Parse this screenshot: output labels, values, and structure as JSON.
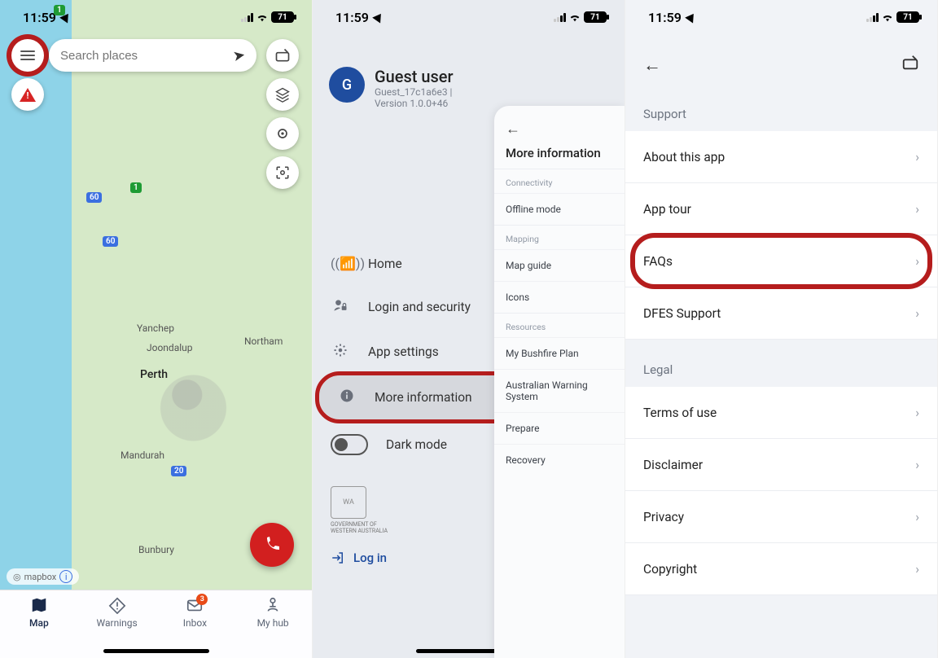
{
  "status_bar": {
    "time": "11:59",
    "battery": "71"
  },
  "screen1": {
    "search_placeholder": "Search places",
    "route60": "60",
    "route60b": "60",
    "route20": "20",
    "badge1": "1",
    "badge1b": "1",
    "label_yanchep": "Yanchep",
    "label_northam": "Northam",
    "label_joondalup": "Joondalup",
    "label_perth": "Perth",
    "label_mandurah": "Mandurah",
    "label_bunbury": "Bunbury",
    "mapbox": "mapbox",
    "tabs": {
      "map": "Map",
      "warnings": "Warnings",
      "inbox": "Inbox",
      "inbox_count": "3",
      "myhub": "My hub"
    }
  },
  "screen2": {
    "avatar_letter": "G",
    "user_name": "Guest user",
    "user_id": "Guest_17c1a6e3 |",
    "version": "Version 1.0.0+46",
    "items": {
      "home": "Home",
      "login": "Login and security",
      "settings": "App settings",
      "more": "More information",
      "dark": "Dark mode"
    },
    "gov_line1": "GOVERNMENT OF",
    "gov_line2": "WESTERN AUSTRALIA",
    "login_action": "Log in",
    "panel": {
      "title": "More information",
      "sec_connectivity": "Connectivity",
      "offline": "Offline mode",
      "sec_mapping": "Mapping",
      "map_guide": "Map guide",
      "icons": "Icons",
      "sec_resources": "Resources",
      "bushfire": "My Bushfire Plan",
      "aws": "Australian Warning System",
      "prepare": "Prepare",
      "recovery": "Recovery"
    }
  },
  "screen3": {
    "support_title": "Support",
    "about": "About this app",
    "tour": "App tour",
    "faqs": "FAQs",
    "dfes": "DFES Support",
    "legal_title": "Legal",
    "terms": "Terms of use",
    "disclaimer": "Disclaimer",
    "privacy": "Privacy",
    "copyright": "Copyright"
  }
}
